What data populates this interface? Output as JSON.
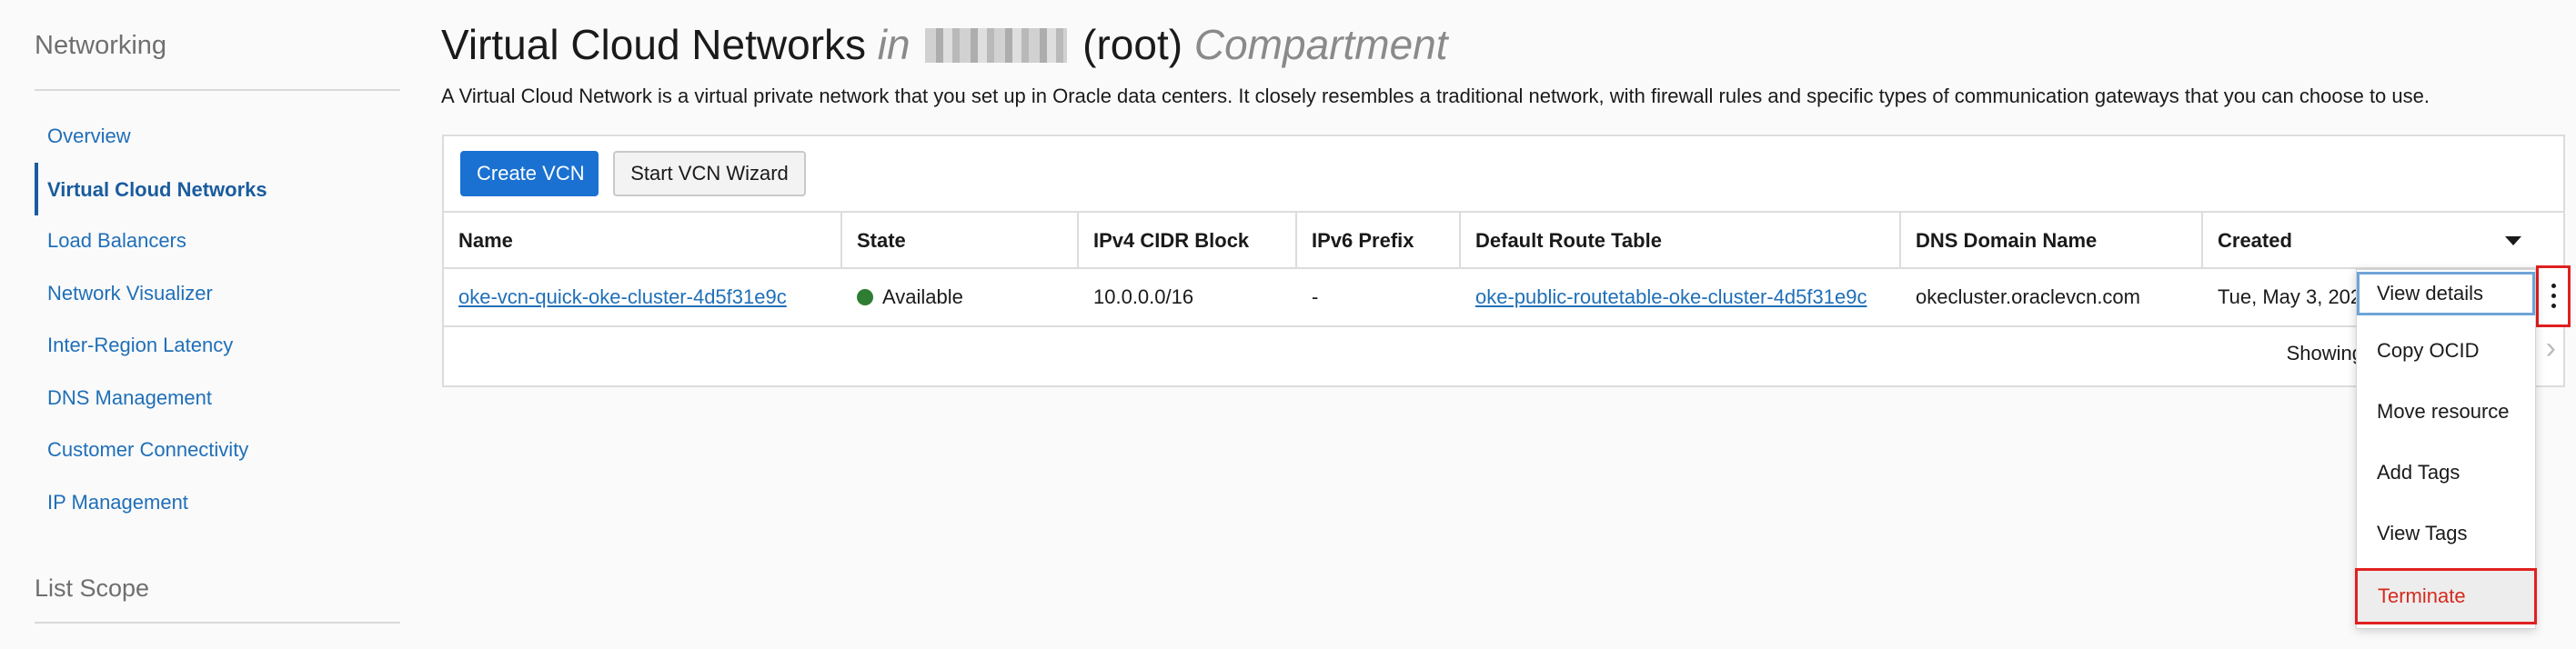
{
  "sidebar": {
    "title": "Networking",
    "items": [
      {
        "label": "Overview"
      },
      {
        "label": "Virtual Cloud Networks"
      },
      {
        "label": "Load Balancers"
      },
      {
        "label": "Network Visualizer"
      },
      {
        "label": "Inter-Region Latency"
      },
      {
        "label": "DNS Management"
      },
      {
        "label": "Customer Connectivity"
      },
      {
        "label": "IP Management"
      }
    ],
    "scope_title": "List Scope"
  },
  "header": {
    "title": "Virtual Cloud Networks",
    "in": "in",
    "root": "(root)",
    "compartment": "Compartment",
    "description": "A Virtual Cloud Network is a virtual private network that you set up in Oracle data centers. It closely resembles a traditional network, with firewall rules and specific types of communication gateways that you can choose to use."
  },
  "toolbar": {
    "create_label": "Create VCN",
    "wizard_label": "Start VCN Wizard"
  },
  "table": {
    "columns": [
      "Name",
      "State",
      "IPv4 CIDR Block",
      "IPv6 Prefix",
      "Default Route Table",
      "DNS Domain Name",
      "Created"
    ],
    "rows": [
      {
        "name": "oke-vcn-quick-oke-cluster-4d5f31e9c",
        "state": "Available",
        "ipv4": "10.0.0.0/16",
        "ipv6": "-",
        "route_table": "oke-public-routetable-oke-cluster-4d5f31e9c",
        "dns": "okecluster.oraclevcn.com",
        "created": "Tue, May 3, 202"
      }
    ],
    "pager_text": "Showing"
  },
  "actions_menu": {
    "items": [
      {
        "label": "View details"
      },
      {
        "label": "Copy OCID"
      },
      {
        "label": "Move resource"
      },
      {
        "label": "Add Tags"
      },
      {
        "label": "View Tags"
      },
      {
        "label": "Terminate"
      }
    ]
  },
  "colors": {
    "link": "#1f6fb8",
    "primary": "#1a71d1",
    "available": "#2e7d32",
    "danger": "#d52b1e",
    "highlight": "#e02020"
  }
}
